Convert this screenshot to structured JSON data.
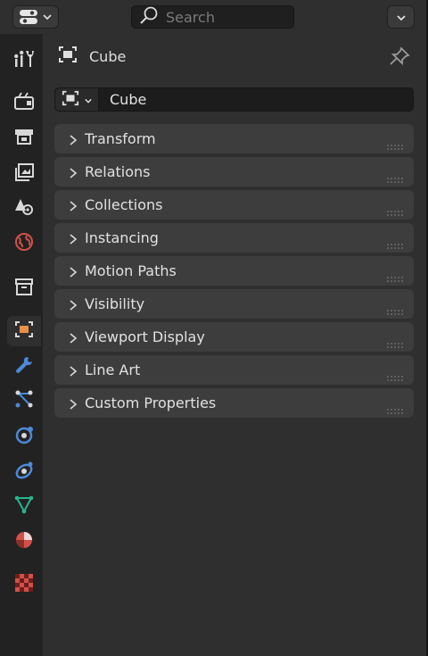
{
  "header": {
    "search_placeholder": "Search"
  },
  "context": {
    "object_name": "Cube"
  },
  "name_field": {
    "value": "Cube"
  },
  "sidebar_tabs": [
    {
      "name": "tool-icon"
    },
    {
      "name": "render-icon"
    },
    {
      "name": "output-icon"
    },
    {
      "name": "view-layer-icon"
    },
    {
      "name": "scene-icon"
    },
    {
      "name": "world-icon"
    },
    {
      "name": "collection-icon"
    },
    {
      "name": "object-icon",
      "active": true
    },
    {
      "name": "modifier-icon"
    },
    {
      "name": "particles-icon"
    },
    {
      "name": "physics-icon"
    },
    {
      "name": "constraints-icon"
    },
    {
      "name": "data-icon"
    },
    {
      "name": "material-icon"
    },
    {
      "name": "texture-icon"
    }
  ],
  "panels": [
    {
      "label": "Transform"
    },
    {
      "label": "Relations"
    },
    {
      "label": "Collections"
    },
    {
      "label": "Instancing"
    },
    {
      "label": "Motion Paths"
    },
    {
      "label": "Visibility"
    },
    {
      "label": "Viewport Display"
    },
    {
      "label": "Line Art"
    },
    {
      "label": "Custom Properties"
    }
  ],
  "colors": {
    "active_tab_accent": "#e8904a",
    "blue_icons": "#4c89d8",
    "green_icon": "#27b58c",
    "red_icons": "#d2504a"
  }
}
